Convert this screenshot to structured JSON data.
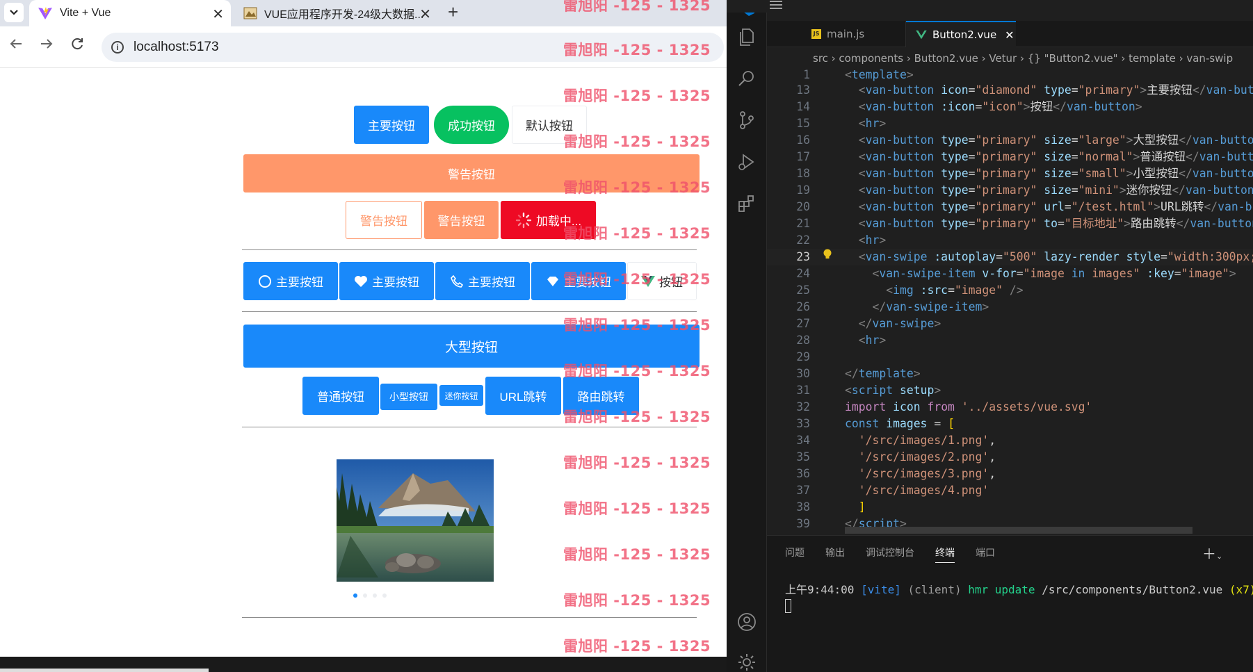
{
  "browser": {
    "tabs": [
      {
        "title": "Vite + Vue",
        "close": "✕"
      },
      {
        "title": "VUE应用程序开发-24级大数据...",
        "close": "✕"
      }
    ],
    "new_tab": "+",
    "url": "localhost:5173"
  },
  "page": {
    "row1": [
      "主要按钮",
      "成功按钮",
      "默认按钮"
    ],
    "warning_block": "警告按钮",
    "row3": [
      "警告按钮",
      "警告按钮",
      "加载中..."
    ],
    "icon_buttons": [
      "主要按钮",
      "主要按钮",
      "主要按钮",
      "主要按钮",
      "按钮"
    ],
    "large_button": "大型按钮",
    "size_buttons": [
      "普通按钮",
      "小型按钮",
      "迷你按钮",
      "URL跳转",
      "路由跳转"
    ],
    "watermark": "雷旭阳 -125 - 1325"
  },
  "vscode": {
    "tabs": [
      "main.js",
      "Button2.vue"
    ],
    "breadcrumb": "src › components › Button2.vue › Vetur › {} \"Button2.vue\" › template › van-swip",
    "panel_tabs": [
      "问题",
      "输出",
      "调试控制台",
      "终端",
      "端口"
    ],
    "terminal": {
      "time": "上午9:44:00",
      "tag": "[vite]",
      "client": "(client)",
      "msg": "hmr update",
      "path": "/src/components/Button2.vue",
      "count": "(x7)"
    }
  }
}
